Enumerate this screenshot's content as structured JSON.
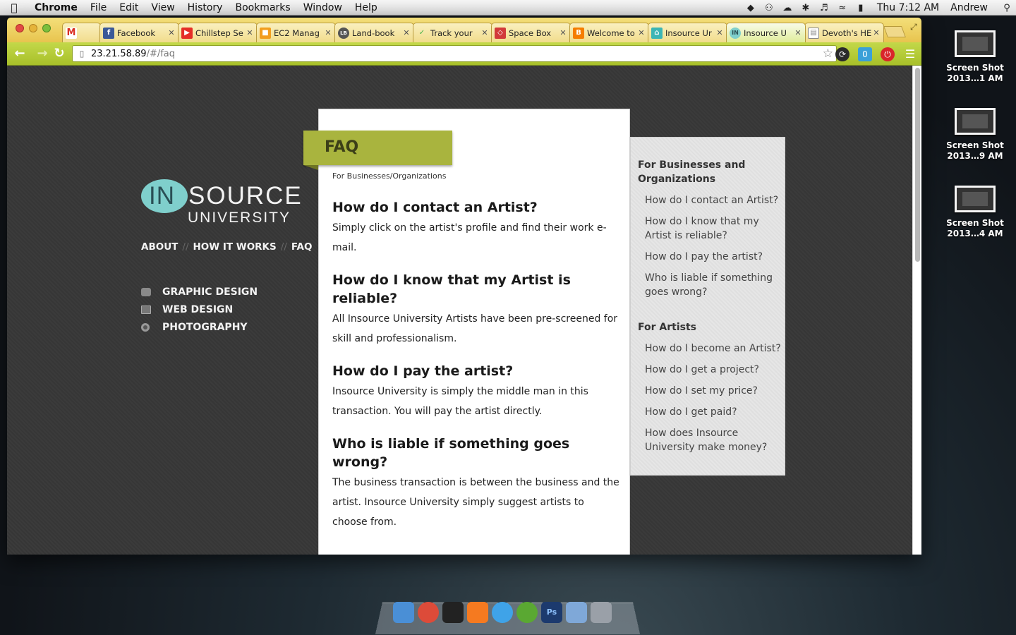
{
  "menubar": {
    "app_name": "Chrome",
    "menus": [
      "File",
      "Edit",
      "View",
      "History",
      "Bookmarks",
      "Window",
      "Help"
    ],
    "clock": "Thu 7:12 AM",
    "user": "Andrew"
  },
  "tabs": [
    {
      "label": "",
      "icon": "gmail-icon",
      "color": "#d93025"
    },
    {
      "label": "Facebook",
      "icon": "facebook-icon",
      "color": "#3b5998"
    },
    {
      "label": "Chillstep Se",
      "icon": "youtube-icon",
      "color": "#e52d27"
    },
    {
      "label": "EC2 Manag",
      "icon": "aws-icon",
      "color": "#f29d1e"
    },
    {
      "label": "Land-book",
      "icon": "landbook-icon",
      "color": "#555555"
    },
    {
      "label": "Track your",
      "icon": "track-icon",
      "color": "#4ab34a"
    },
    {
      "label": "Space Box",
      "icon": "spacebox-icon",
      "color": "#d23a3a"
    },
    {
      "label": "Welcome to",
      "icon": "blogger-icon",
      "color": "#f57d00"
    },
    {
      "label": "Insource Ur",
      "icon": "insource-icon",
      "color": "#3cb5b5"
    },
    {
      "label": "Insource U",
      "icon": "insource-in-icon",
      "color": "#7fcfcc",
      "active": true
    },
    {
      "label": "Devoth's HE",
      "icon": "document-icon",
      "color": "#888888"
    }
  ],
  "toolbar": {
    "url_host": "23.21.58.89",
    "url_path": "/#/faq",
    "extension_badge": "0"
  },
  "site": {
    "logo": {
      "in": "IN",
      "source": "SOURCE",
      "university": "UNIVERSITY"
    },
    "main_nav": [
      "ABOUT",
      "HOW IT WORKS",
      "FAQ"
    ],
    "main_nav_separator": "//",
    "categories": [
      {
        "label": "GRAPHIC DESIGN",
        "icon": "graphic-design-icon"
      },
      {
        "label": "WEB DESIGN",
        "icon": "web-design-icon"
      },
      {
        "label": "PHOTOGRAPHY",
        "icon": "camera-icon"
      }
    ]
  },
  "faq": {
    "title": "FAQ",
    "section_label": "For Businesses/Organizations",
    "items": [
      {
        "question": "How do I contact an Artist?",
        "answer": "Simply click on the artist's profile and find their work e-mail."
      },
      {
        "question": "How do I know that my Artist is reliable?",
        "answer": "All Insource University Artists have been pre-screened for skill and professionalism."
      },
      {
        "question": "How do I pay the artist?",
        "answer": "Insource University is simply the middle man in this transaction. You will pay the artist directly."
      },
      {
        "question": "Who is liable if something goes wrong?",
        "answer": "The business transaction is between the business and the artist. Insource University simply suggest artists to choose from."
      }
    ]
  },
  "sidebar": {
    "business_heading": "For Businesses and Organizations",
    "business_links": [
      "How do I contact an Artist?",
      "How do I know that my Artist is reliable?",
      "How do I pay the artist?",
      "Who is liable if something goes wrong?"
    ],
    "artist_heading": "For Artists",
    "artist_links": [
      "How do I become an Artist?",
      "How do I get a project?",
      "How do I set my price?",
      "How do I get paid?",
      "How does Insource University make money?"
    ]
  },
  "desktop": {
    "files": [
      {
        "line1": "Screen Shot",
        "line2": "2013…1 AM"
      },
      {
        "line1": "Screen Shot",
        "line2": "2013…9 AM"
      },
      {
        "line1": "Screen Shot",
        "line2": "2013…4 AM"
      }
    ]
  },
  "dock": {
    "apps": [
      {
        "icon": "finder-icon",
        "color": "#4a8fd6"
      },
      {
        "icon": "chrome-icon",
        "color": "#dd4b39"
      },
      {
        "icon": "terminal-icon",
        "color": "#222222"
      },
      {
        "icon": "xampp-icon",
        "color": "#f57a20"
      },
      {
        "icon": "messages-icon",
        "color": "#3fa3e8"
      },
      {
        "icon": "adium-icon",
        "color": "#5aa832"
      },
      {
        "icon": "photoshop-icon",
        "color": "#1c3a6e",
        "text": "Ps"
      },
      {
        "icon": "applications-folder-icon",
        "color": "#7fa8d8"
      },
      {
        "icon": "trash-icon",
        "color": "#9aa0a8"
      }
    ]
  }
}
